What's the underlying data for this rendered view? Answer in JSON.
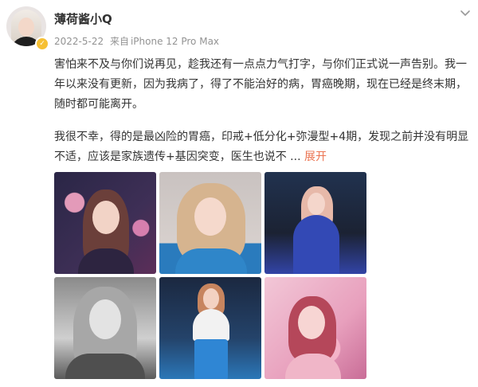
{
  "post": {
    "author": "薄荷酱小Q",
    "date": "2022-5-22",
    "source_prefix": "来自",
    "source_device": "iPhone 12 Pro Max",
    "paragraph1": "害怕来不及与你们说再见，趁我还有一点点力气打字，与你们正式说一声告别。我一年以来没有更新，因为我病了，得了不能治好的病，胃癌晚期，现在已经是终末期，随时都可能离开。",
    "paragraph2": "我很不幸，得的是最凶险的胃癌，印戒+低分化+弥漫型+4期，发现之前并没有明显不适，应该是家族遗传+基因突变，医生也说不",
    "ellipsis": " ...",
    "expand_label": "展开"
  },
  "icons": {
    "verified": "verified-badge-icon",
    "more": "chevron-down-icon"
  },
  "colors": {
    "accent_expand": "#eb7350",
    "verified_badge": "#f6c034",
    "meta_gray": "#939393"
  },
  "images": [
    {
      "alt": "photo-1"
    },
    {
      "alt": "photo-2"
    },
    {
      "alt": "photo-3"
    },
    {
      "alt": "photo-4"
    },
    {
      "alt": "photo-5"
    },
    {
      "alt": "photo-6"
    }
  ]
}
